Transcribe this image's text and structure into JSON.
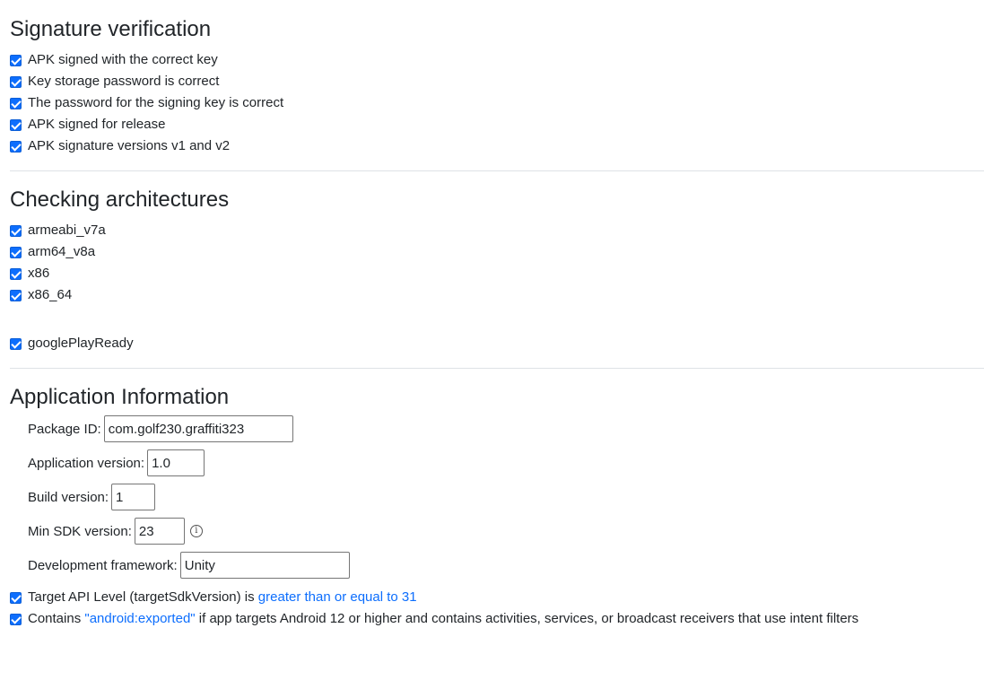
{
  "signature": {
    "title": "Signature verification",
    "items": [
      "APK signed with the correct key",
      "Key storage password is correct",
      "The password for the signing key is correct",
      "APK signed for release",
      "APK signature versions v1 and v2"
    ]
  },
  "architectures": {
    "title": "Checking architectures",
    "items": [
      "armeabi_v7a",
      "arm64_v8a",
      "x86",
      "x86_64"
    ],
    "google_play_ready": "googlePlayReady"
  },
  "app_info": {
    "title": "Application Information",
    "package_id": {
      "label": "Package ID:",
      "value": "com.golf230.graffiti323"
    },
    "app_version": {
      "label": "Application version:",
      "value": "1.0"
    },
    "build_version": {
      "label": "Build version:",
      "value": "1"
    },
    "min_sdk": {
      "label": "Min SDK version:",
      "value": "23",
      "info_icon": "info-icon"
    },
    "framework": {
      "label": "Development framework:",
      "value": "Unity"
    },
    "target_api": {
      "prefix": "Target API Level (targetSdkVersion) is ",
      "link": "greater than or equal to 31"
    },
    "exported": {
      "prefix": "Contains ",
      "link": "\"android:exported\"",
      "suffix": " if app targets Android 12 or higher and contains activities, services, or broadcast receivers that use intent filters"
    }
  },
  "colors": {
    "accent": "#0d6efd",
    "text": "#212529",
    "divider": "#dee2e6"
  }
}
